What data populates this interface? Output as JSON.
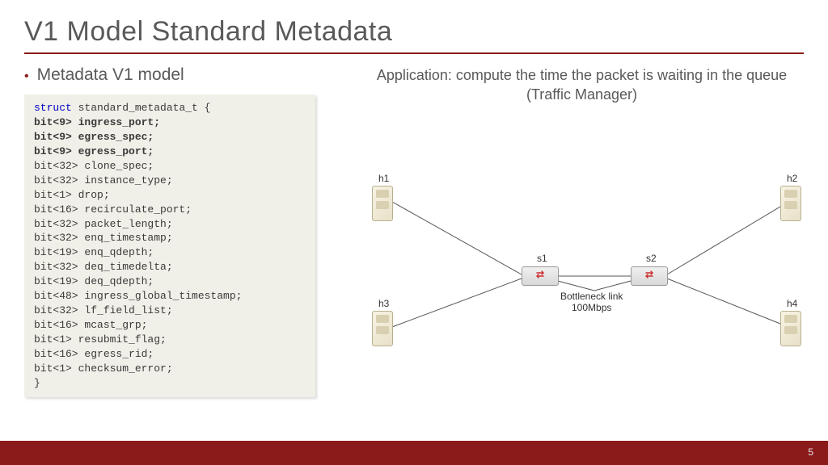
{
  "title": "V1 Model Standard Metadata",
  "bullet_text": "Metadata V1 model",
  "application_text": "Application: compute the time the packet is waiting in the queue (Traffic Manager)",
  "code": {
    "keyword": "struct",
    "name": "standard_metadata_t {",
    "fields": [
      {
        "type": "bit<9>",
        "name": "ingress_port;",
        "bold": true
      },
      {
        "type": "bit<9>",
        "name": "egress_spec;",
        "bold": true
      },
      {
        "type": "bit<9>",
        "name": "egress_port;",
        "bold": true
      },
      {
        "type": "bit<32>",
        "name": "clone_spec;",
        "bold": false
      },
      {
        "type": "bit<32>",
        "name": "instance_type;",
        "bold": false
      },
      {
        "type": "bit<1>",
        "name": "drop;",
        "bold": false
      },
      {
        "type": "bit<16>",
        "name": "recirculate_port;",
        "bold": false
      },
      {
        "type": "bit<32>",
        "name": "packet_length;",
        "bold": false
      },
      {
        "type": "bit<32>",
        "name": "enq_timestamp;",
        "bold": false
      },
      {
        "type": "bit<19>",
        "name": "enq_qdepth;",
        "bold": false
      },
      {
        "type": "bit<32>",
        "name": "deq_timedelta;",
        "bold": false
      },
      {
        "type": "bit<19>",
        "name": "deq_qdepth;",
        "bold": false
      },
      {
        "type": "bit<48>",
        "name": "ingress_global_timestamp;",
        "bold": false
      },
      {
        "type": "bit<32>",
        "name": "lf_field_list;",
        "bold": false
      },
      {
        "type": "bit<16>",
        "name": "mcast_grp;",
        "bold": false
      },
      {
        "type": "bit<1>",
        "name": "resubmit_flag;",
        "bold": false
      },
      {
        "type": "bit<16>",
        "name": "egress_rid;",
        "bold": false
      },
      {
        "type": "bit<1>",
        "name": "checksum_error;",
        "bold": false
      }
    ],
    "close": "}"
  },
  "diagram": {
    "hosts": {
      "h1": "h1",
      "h2": "h2",
      "h3": "h3",
      "h4": "h4"
    },
    "switches": {
      "s1": "s1",
      "s2": "s2"
    },
    "bottleneck_line1": "Bottleneck link",
    "bottleneck_line2": "100Mbps"
  },
  "page_number": "5"
}
